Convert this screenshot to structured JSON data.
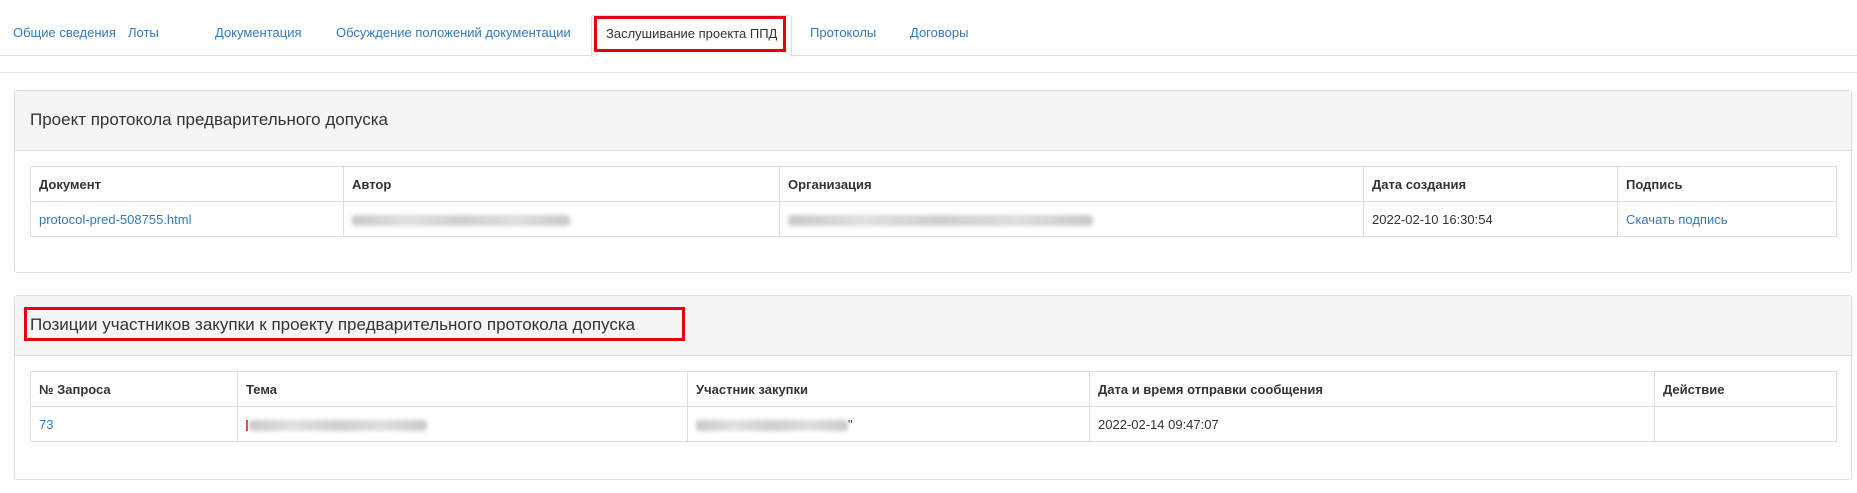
{
  "tabs": {
    "general": "Общие сведения",
    "lots": "Лоты",
    "docs": "Документация",
    "discussion": "Обсуждение положений документации",
    "hearing": "Заслушивание проекта ППД",
    "protocols": "Протоколы",
    "contracts": "Договоры"
  },
  "panel_protocol": {
    "title": "Проект протокола предварительного допуска",
    "columns": {
      "document": "Документ",
      "author": "Автор",
      "organization": "Организация",
      "created": "Дата создания",
      "signature": "Подпись"
    },
    "row": {
      "document": "protocol-pred-508755.html",
      "created": "2022-02-10 16:30:54",
      "signature": "Скачать подпись"
    }
  },
  "panel_positions": {
    "title": "Позиции участников закупки к проекту предварительного протокола допуска",
    "columns": {
      "request_no": "№ Запроса",
      "topic": "Тема",
      "participant": "Участник закупки",
      "sent_at": "Дата и время отправки сообщения",
      "action": "Действие"
    },
    "row": {
      "request_no": "73",
      "participant_tail": "\"",
      "sent_at": "2022-02-14 09:47:07",
      "action": ""
    }
  },
  "colors": {
    "link": "#337ab7",
    "highlight": "#e8000d",
    "panel_heading_bg": "#f5f5f5",
    "border": "#dddddd"
  }
}
